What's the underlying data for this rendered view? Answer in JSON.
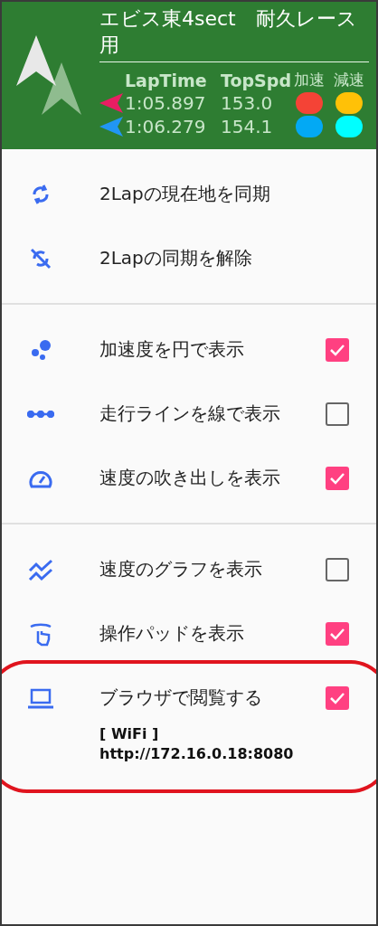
{
  "header": {
    "title": "エビス東4sect　耐久レース用",
    "columns": [
      "LapTime",
      "TopSpd",
      "加速",
      "減速"
    ],
    "laps": [
      {
        "color": "#e91e63",
        "time": "1:05.897",
        "speed": "153.0",
        "dots": [
          {
            "color": "#f44336"
          },
          {
            "color": "#ffc107"
          }
        ]
      },
      {
        "color": "#2196f3",
        "time": "1:06.279",
        "speed": "154.1",
        "dots": [
          {
            "color": "#03a9f4"
          },
          {
            "color": "#00ffff"
          }
        ]
      }
    ]
  },
  "sections": [
    {
      "items": [
        {
          "kind": "action",
          "label": "2Lapの現在地を同期"
        },
        {
          "kind": "action",
          "label": "2Lapの同期を解除"
        }
      ]
    },
    {
      "items": [
        {
          "kind": "toggle",
          "label": "加速度を円で表示",
          "checked": true
        },
        {
          "kind": "toggle",
          "label": "走行ラインを線で表示",
          "checked": false
        },
        {
          "kind": "toggle",
          "label": "速度の吹き出しを表示",
          "checked": true
        }
      ]
    },
    {
      "items": [
        {
          "kind": "toggle",
          "label": "速度のグラフを表示",
          "checked": false
        },
        {
          "kind": "toggle",
          "label": "操作パッドを表示",
          "checked": true
        },
        {
          "kind": "toggle",
          "label": "ブラウザで閲覧する",
          "checked": true,
          "highlighted": true,
          "note": [
            "[ WiFi ]",
            "http://172.16.0.18:8080"
          ]
        }
      ]
    }
  ]
}
